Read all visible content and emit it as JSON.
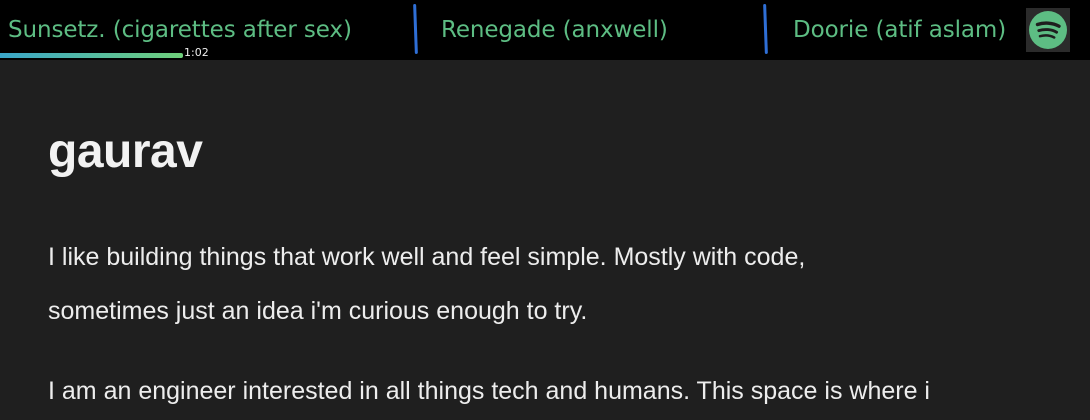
{
  "player": {
    "tracks": [
      {
        "label": "Sunsetz. (cigarettes after sex)"
      },
      {
        "label": "Renegade (anxwell)"
      },
      {
        "label": "Doorie (atif aslam)"
      }
    ],
    "elapsed": "1:02",
    "progress_fraction": 0.168,
    "service_icon": "spotify-icon",
    "colors": {
      "background": "#000000",
      "track_text": "#5dbd83",
      "divider": "#2f6fd6",
      "progress_start": "#3aa6c9",
      "progress_end": "#6fcf7a"
    }
  },
  "profile": {
    "name": "gaurav",
    "paragraphs": [
      {
        "lines": [
          "I like building things that work well and feel simple. Mostly with code,",
          "sometimes just an idea i'm curious enough to try."
        ]
      },
      {
        "lines": [
          "I am an engineer interested in all things tech and humans. This space is where i"
        ]
      }
    ]
  },
  "colors": {
    "page_background": "#1f1f1f",
    "text": "#ededed"
  }
}
